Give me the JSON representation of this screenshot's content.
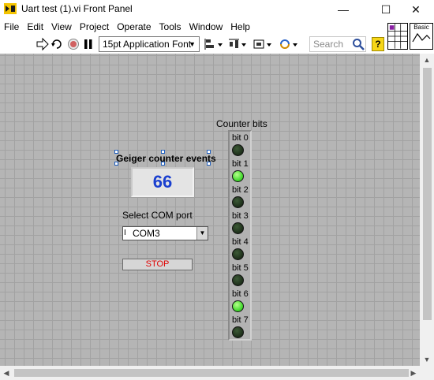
{
  "window": {
    "title": "Uart test (1).vi Front Panel",
    "minimize": "—",
    "maximize": "☐",
    "close": "✕"
  },
  "menu": [
    "File",
    "Edit",
    "View",
    "Project",
    "Operate",
    "Tools",
    "Window",
    "Help"
  ],
  "toolbar": {
    "font": "15pt Application Font",
    "search_placeholder": "Search",
    "help": "?"
  },
  "icon_label": "Basic",
  "geiger": {
    "label": "Geiger counter events",
    "value": "66"
  },
  "com": {
    "label": "Select COM port",
    "value": "COM3"
  },
  "stop_label": "STOP",
  "counter": {
    "title": "Counter bits",
    "bits": [
      {
        "label": "bit 0",
        "on": false
      },
      {
        "label": "bit 1",
        "on": true
      },
      {
        "label": "bit 2",
        "on": false
      },
      {
        "label": "bit 3",
        "on": false
      },
      {
        "label": "bit 4",
        "on": false
      },
      {
        "label": "bit 5",
        "on": false
      },
      {
        "label": "bit 6",
        "on": true
      },
      {
        "label": "bit 7",
        "on": false
      }
    ]
  },
  "colors": {
    "numeric_text": "#1a3fcf",
    "stop_text": "#e00000",
    "led_on": "#3fd82b",
    "led_off": "#24371f",
    "panel_bg": "#b5b5b5"
  }
}
